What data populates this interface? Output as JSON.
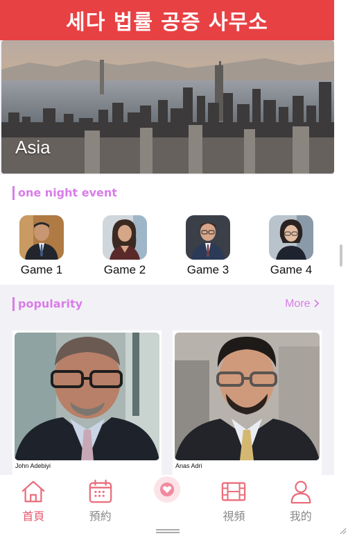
{
  "header": {
    "title": "세다 법률 공증 사무소"
  },
  "banner": {
    "caption": "Asia"
  },
  "events": {
    "title": "one night event",
    "games": [
      {
        "label": "Game 1"
      },
      {
        "label": "Game 2"
      },
      {
        "label": "Game 3"
      },
      {
        "label": "Game 4"
      }
    ]
  },
  "popularity": {
    "title": "popularity",
    "more_label": "More",
    "more_icon": "chevron-right-icon",
    "cards": [
      {
        "name": "John Adebiyi"
      },
      {
        "name": "Anas Adri"
      }
    ]
  },
  "tabbar": {
    "tabs": [
      {
        "label": "首頁",
        "icon": "home-icon",
        "active": true
      },
      {
        "label": "預約",
        "icon": "calendar-icon",
        "active": false
      },
      {
        "label": "",
        "icon": "heart-icon",
        "active": false
      },
      {
        "label": "視頻",
        "icon": "film-icon",
        "active": false
      },
      {
        "label": "我的",
        "icon": "user-icon",
        "active": false
      }
    ]
  },
  "colors": {
    "header_bg": "#e84144",
    "accent_purple": "#d97ce9",
    "tab_active": "#e85a6e",
    "tab_inactive": "#888888"
  }
}
